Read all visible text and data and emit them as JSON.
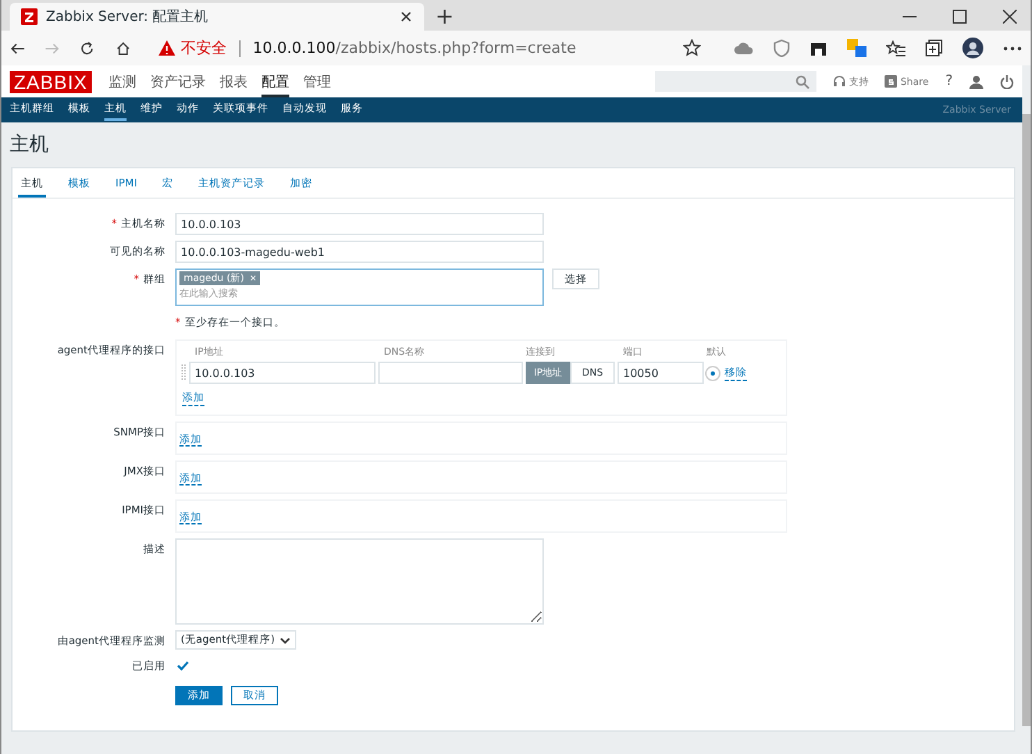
{
  "browser": {
    "tab_title": "Zabbix Server: 配置主机",
    "new_tab": "+",
    "warning": "不安全",
    "url_host": "10.0.0.100",
    "url_path": "/zabbix/hosts.php?form=create"
  },
  "header": {
    "logo": "ZABBIX",
    "menu": [
      {
        "label": "监测",
        "selected": false
      },
      {
        "label": "资产记录",
        "selected": false
      },
      {
        "label": "报表",
        "selected": false
      },
      {
        "label": "配置",
        "selected": true
      },
      {
        "label": "管理",
        "selected": false
      }
    ],
    "support": "支持",
    "share": "Share",
    "help": "?"
  },
  "submenu": {
    "items": [
      {
        "label": "主机群组",
        "selected": false
      },
      {
        "label": "模板",
        "selected": false
      },
      {
        "label": "主机",
        "selected": true
      },
      {
        "label": "维护",
        "selected": false
      },
      {
        "label": "动作",
        "selected": false
      },
      {
        "label": "关联项事件",
        "selected": false
      },
      {
        "label": "自动发现",
        "selected": false
      },
      {
        "label": "服务",
        "selected": false
      }
    ],
    "server": "Zabbix Server"
  },
  "page_title": "主机",
  "form_tabs": [
    {
      "label": "主机",
      "selected": true
    },
    {
      "label": "模板",
      "selected": false
    },
    {
      "label": "IPMI",
      "selected": false
    },
    {
      "label": "宏",
      "selected": false
    },
    {
      "label": "主机资产记录",
      "selected": false
    },
    {
      "label": "加密",
      "selected": false
    }
  ],
  "host_name": {
    "required_mark": "*",
    "label": "主机名称",
    "value": "10.0.0.103"
  },
  "visible_name": {
    "label": "可见的名称",
    "value": "10.0.0.103-magedu-web1"
  },
  "groups": {
    "required_mark": "*",
    "label": "群组",
    "tags": [
      {
        "label": "magedu (新)",
        "remove": "✕"
      }
    ],
    "placeholder": "在此输入搜索",
    "button": "选择"
  },
  "interface_note": {
    "required_mark": "*",
    "text": "至少存在一个接口。"
  },
  "agent_interfaces": {
    "label": "agent代理程序的接口",
    "columns": [
      "IP地址",
      "DNS名称",
      "连接到",
      "端口",
      "默认"
    ],
    "rows": [
      {
        "ip": "10.0.0.103",
        "dns": "",
        "connect": [
          {
            "label": "IP地址",
            "selected": true
          },
          {
            "label": "DNS",
            "selected": false
          }
        ],
        "port": "10050",
        "default": true,
        "remove": "移除"
      }
    ],
    "add": "添加"
  },
  "other_interfaces": [
    {
      "label": "SNMP接口",
      "add": "添加"
    },
    {
      "label": "JMX接口",
      "add": "添加"
    },
    {
      "label": "IPMI接口",
      "add": "添加"
    }
  ],
  "description": {
    "label": "描述"
  },
  "proxy": {
    "label": "由agent代理程序监测",
    "value": "(无agent代理程序)"
  },
  "enabled": {
    "label": "已启用",
    "checked": true
  },
  "buttons": [
    {
      "label": "添加",
      "kind": "primary"
    },
    {
      "label": "取消",
      "kind": "secondary"
    }
  ]
}
